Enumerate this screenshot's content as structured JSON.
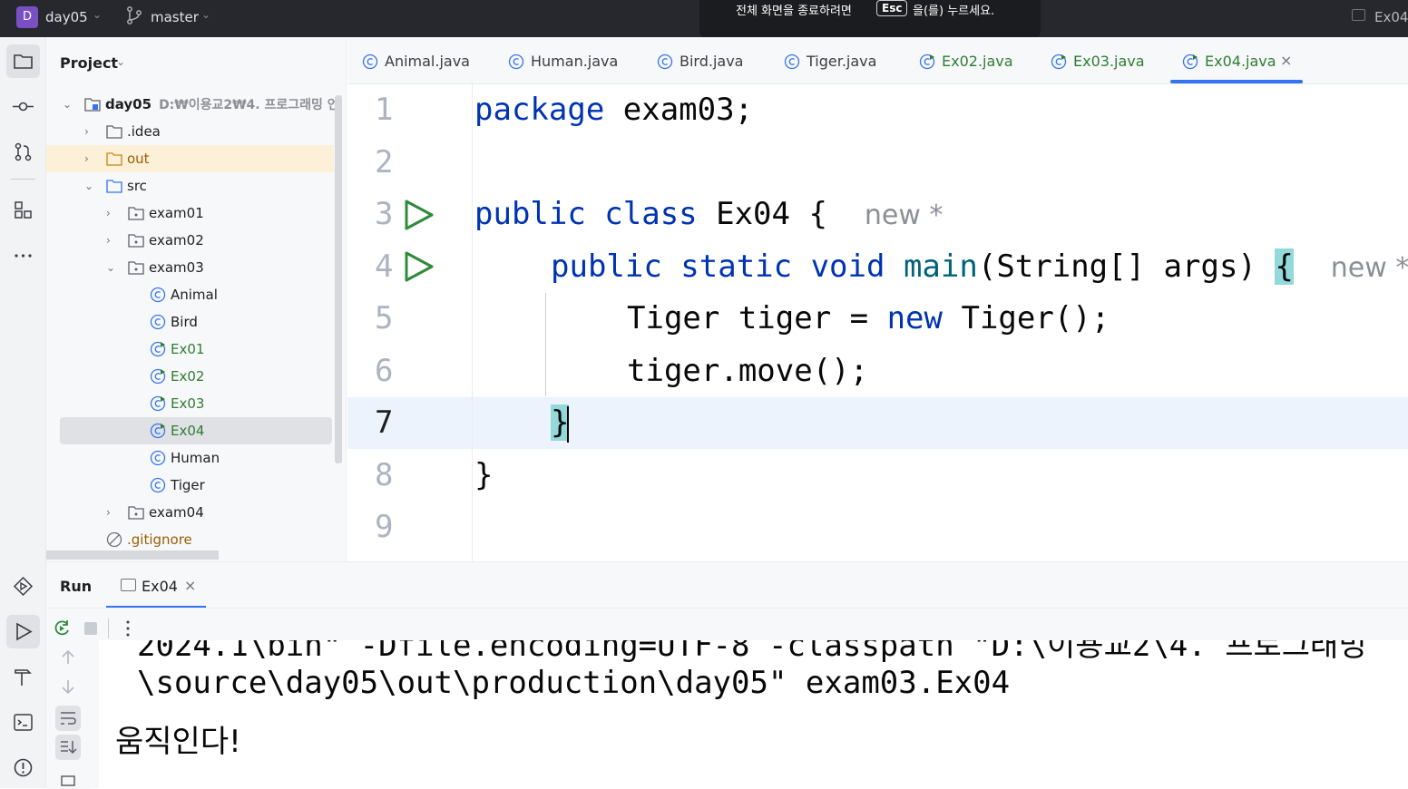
{
  "titlebar": {
    "project_badge": "D",
    "project_name": "day05",
    "branch": "master",
    "fullscreen_notice_before": "전체 화면을 종료하려면",
    "fullscreen_key": "Esc",
    "fullscreen_notice_after": "을(를) 누르세요.",
    "run_config": "Ex04"
  },
  "project": {
    "header": "Project",
    "root_name": "day05",
    "root_path": "D:₩이용교2₩4. 프로그래밍 언",
    "items": {
      "idea": ".idea",
      "out": "out",
      "src": "src",
      "exam01": "exam01",
      "exam02": "exam02",
      "exam03": "exam03",
      "animal": "Animal",
      "bird": "Bird",
      "ex01": "Ex01",
      "ex02": "Ex02",
      "ex03": "Ex03",
      "ex04": "Ex04",
      "human": "Human",
      "tiger": "Tiger",
      "exam04": "exam04",
      "gitignore": ".gitignore"
    }
  },
  "tabs": [
    {
      "label": "Animal.java"
    },
    {
      "label": "Human.java"
    },
    {
      "label": "Bird.java"
    },
    {
      "label": "Tiger.java"
    },
    {
      "label": "Ex02.java"
    },
    {
      "label": "Ex03.java"
    },
    {
      "label": "Ex04.java",
      "active": true
    }
  ],
  "editor": {
    "line_numbers": [
      "1",
      "2",
      "3",
      "4",
      "5",
      "6",
      "7",
      "8",
      "9"
    ],
    "current_line": 7,
    "lines": {
      "l1_kw": "package",
      "l1_rest": " exam03;",
      "l3_kw": "public class",
      "l3_rest": " Ex04 { ",
      "l3_hint": "new *",
      "l4_kw": "public static void",
      "l4_fn": "main",
      "l4_rest": "(String[] args) ",
      "l4_brace": "{",
      "l4_hint": "new *",
      "l5_a": "Tiger tiger = ",
      "l5_kw": "new",
      "l5_b": " Tiger();",
      "l6": "tiger.move();",
      "l7": "}",
      "l8": "}"
    }
  },
  "run": {
    "title": "Run",
    "tab_label": "Ex04",
    "console": {
      "line_clipped": "2024.1\\bin\" -Dfile.encoding=UTF-8 -classpath \"D:\\이용교2\\4. 프로그래밍",
      "line_path": "\\source\\day05\\out\\production\\day05\" exam03.Ex04",
      "output": "움직인다!"
    }
  },
  "colors": {
    "accent": "#3574f0",
    "keyword": "#0033b3",
    "method": "#00627a",
    "titlebar": "#27282e"
  }
}
